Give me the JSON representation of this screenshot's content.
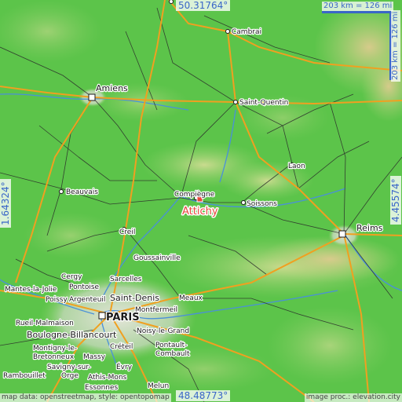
{
  "coordinates": {
    "top": "50.31764°",
    "bottom": "48.48773°",
    "left": "1.64324°",
    "right": "4.45574°"
  },
  "scale": {
    "horizontal": "203 km = 126 mi",
    "vertical": "203 km = 126 mi"
  },
  "marker": {
    "name": "Attichy",
    "color": "#e8463c"
  },
  "places": {
    "cambrai": "Cambrai",
    "amiens": "Amiens",
    "saint_quentin": "Saint-Quentin",
    "laon": "Laon",
    "compiegne": "Compiègne",
    "soissons": "Soissons",
    "beauvais": "Beauvais",
    "reims": "Reims",
    "creil": "Creil",
    "goussainville": "Goussainville",
    "cergy": "Cergy",
    "sarcelles": "Sarcelles",
    "mantes": "Mantes-la-Jolie",
    "pontoise": "Pontoise",
    "poissy": "Poissy",
    "argenteuil": "Argenteuil",
    "saint_denis": "Saint-Denis",
    "meaux": "Meaux",
    "montfermeil": "Montfermeil",
    "rueil": "Rueil-Malmaison",
    "paris": "PARIS",
    "noisy": "Noisy-le-Grand",
    "boulogne": "Boulogne-Billancourt",
    "creteil": "Créteil",
    "montigny": "Montigny-le-",
    "bretonneux": "Bretonneux",
    "pontault": "Pontault-",
    "combault": "Combault",
    "massy": "Massy",
    "savigny": "Savigny-sur-",
    "orge": "Orge",
    "evry": "Évry",
    "rambouillet": "Rambouillet",
    "athis": "Athis-Mons",
    "essonnes": "Essonnes",
    "melun": "Melun"
  },
  "attribution": {
    "left": "map data: openstreetmap, style: opentopomap",
    "right": "image proc.: elevation.city"
  },
  "colors": {
    "lowland": "#5cc44a",
    "hills": "#c8d88a",
    "highland": "#d9c58c",
    "motorway": "#f0a020",
    "road": "#2a2a2a",
    "water": "#4a90d9",
    "urban": "#e8e4de"
  }
}
